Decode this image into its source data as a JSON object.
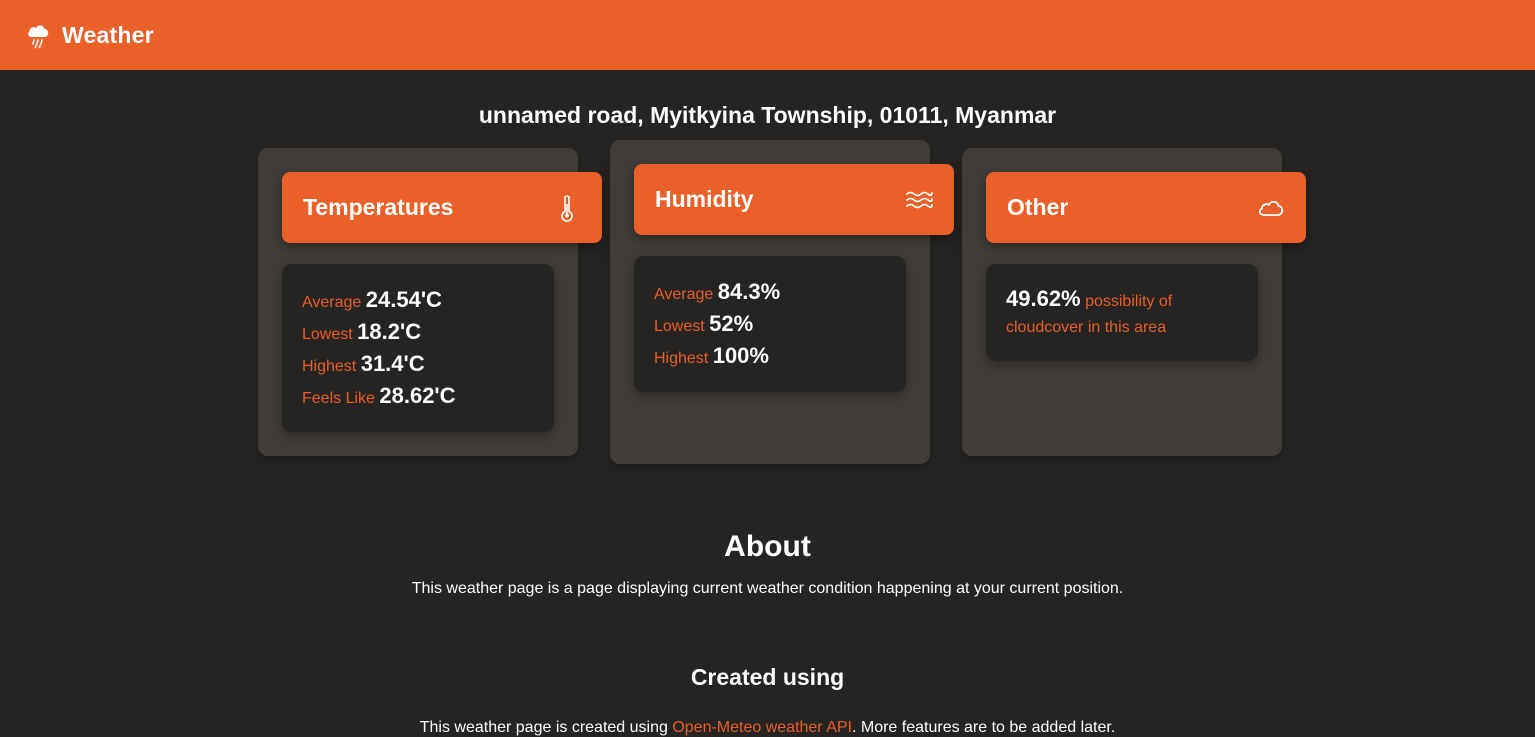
{
  "app": {
    "title": "Weather",
    "icon": "cloud-rain-icon"
  },
  "location": "unnamed road, Myitkyina Township, 01011, Myanmar",
  "cards": {
    "temperatures": {
      "title": "Temperatures",
      "icon": "thermometer-icon",
      "average_label": "Average",
      "average_value": "24.54'C",
      "lowest_label": "Lowest",
      "lowest_value": "18.2'C",
      "highest_label": "Highest",
      "highest_value": "31.4'C",
      "feels_label": "Feels Like",
      "feels_value": "28.62'C"
    },
    "humidity": {
      "title": "Humidity",
      "icon": "water-waves-icon",
      "average_label": "Average",
      "average_value": "84.3%",
      "lowest_label": "Lowest",
      "lowest_value": "52%",
      "highest_label": "Highest",
      "highest_value": "100%"
    },
    "other": {
      "title": "Other",
      "icon": "cloud-icon",
      "cloud_value": "49.62%",
      "cloud_text": "possibility of cloudcover in this area"
    }
  },
  "about": {
    "title": "About",
    "text": "This weather page is a page displaying current weather condition happening at your current position."
  },
  "created": {
    "title": "Created using",
    "text_before": "This weather page is created using ",
    "link_text": "Open-Meteo weather API",
    "text_after": ". More features are to be added later."
  },
  "colors": {
    "accent": "#eb5f29",
    "background": "#262422",
    "card": "#403c38"
  }
}
